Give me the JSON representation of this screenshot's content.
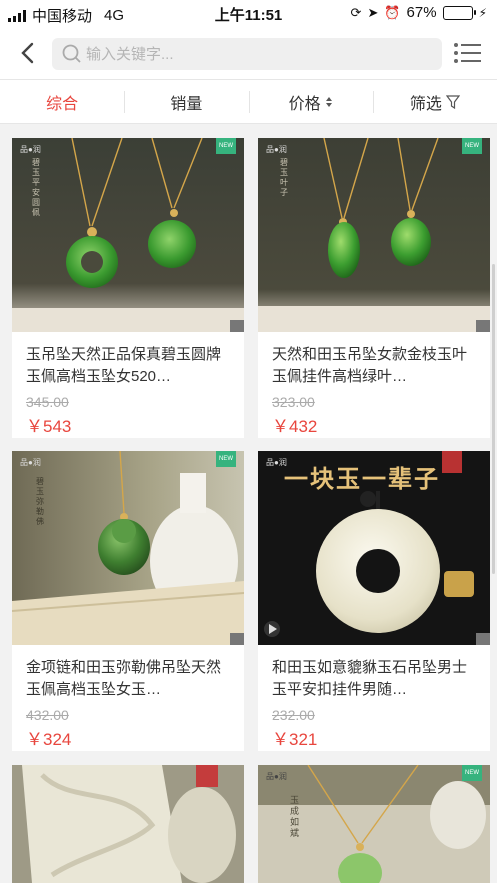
{
  "status": {
    "carrier": "中国移动",
    "network": "4G",
    "time": "上午11:51",
    "battery": "67%",
    "battery_level": 0.67
  },
  "search": {
    "placeholder": "输入关键字..."
  },
  "sort_tabs": [
    {
      "label": "综合",
      "active": true
    },
    {
      "label": "销量"
    },
    {
      "label": "价格"
    },
    {
      "label": "筛选"
    }
  ],
  "products": [
    {
      "title": "玉吊坠天然正品保真碧玉圆牌玉佩高档玉坠女520…",
      "old_price": "345.00",
      "price": "￥543",
      "image_text": "碧玉平安圆佩",
      "tag": "NEW"
    },
    {
      "title": "天然和田玉吊坠女款金枝玉叶玉佩挂件高档绿叶…",
      "old_price": "323.00",
      "price": "￥432",
      "image_text": "碧玉叶子",
      "tag": "NEW"
    },
    {
      "title": "金项链和田玉弥勒佛吊坠天然玉佩高档玉坠女玉…",
      "old_price": "432.00",
      "price": "￥324",
      "image_text": "碧玉弥勒佛",
      "tag": "NEW"
    },
    {
      "title": "和田玉如意貔貅玉石吊坠男士玉平安扣挂件男随…",
      "old_price": "232.00",
      "price": "￥321",
      "image_text": "一块玉一辈子",
      "tag": ""
    },
    {
      "title": "",
      "old_price": "",
      "price": "",
      "image_text": "",
      "tag": ""
    },
    {
      "title": "",
      "old_price": "",
      "price": "",
      "image_text": "玉成如斌",
      "tag": "NEW"
    }
  ],
  "colors": {
    "accent": "#e8463e",
    "jade": "#3e9b3a",
    "tag_green": "#36b37e"
  }
}
